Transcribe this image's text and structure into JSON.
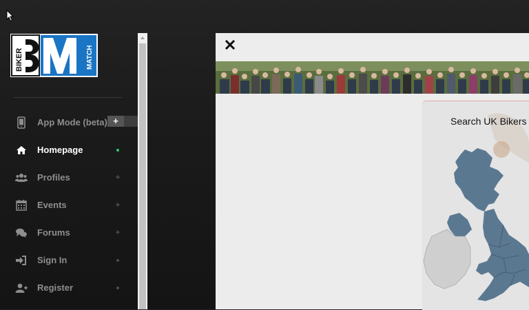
{
  "sidebar": {
    "logo": {
      "biker": "BIKER",
      "match": "MATCH",
      "colors": {
        "blue": "#1a75c4",
        "black": "#111111"
      }
    },
    "items": [
      {
        "label": "App Mode (beta)",
        "icon": "phone-icon",
        "marker": "+",
        "active": false
      },
      {
        "label": "Homepage",
        "icon": "home-icon",
        "marker": "dot-green",
        "active": true
      },
      {
        "label": "Profiles",
        "icon": "users-icon",
        "marker": "+",
        "active": false
      },
      {
        "label": "Events",
        "icon": "calendar-icon",
        "marker": "+",
        "active": false
      },
      {
        "label": "Forums",
        "icon": "chat-icon",
        "marker": "+",
        "active": false
      },
      {
        "label": "Sign In",
        "icon": "sign-in-icon",
        "marker": "dot",
        "active": false
      },
      {
        "label": "Register",
        "icon": "user-plus-icon",
        "marker": "dot",
        "active": false
      }
    ],
    "app_mode_button": "+"
  },
  "panel": {
    "close_icon": "close-icon",
    "map_title": "Search UK Bikers"
  },
  "colors": {
    "accent_green": "#2ecc71",
    "map_land": "#5b7891",
    "ireland_land": "#cfcfcf",
    "panel_bg": "#ececec"
  }
}
